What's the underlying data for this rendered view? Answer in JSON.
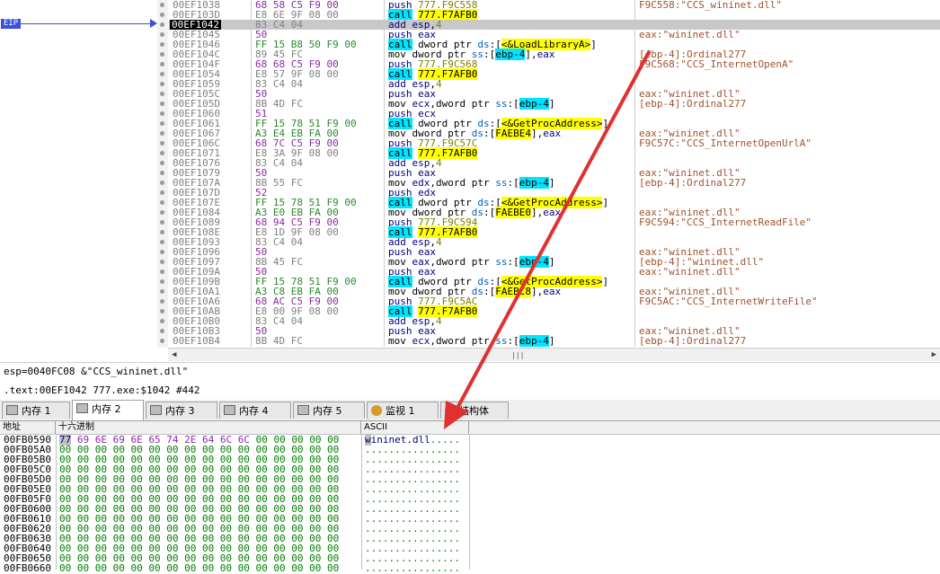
{
  "eip_label": "EIP",
  "disasm": {
    "rows": [
      {
        "addr": "00EF1038",
        "bytes": "68 58 C5 F9 00",
        "bclass": "p",
        "ins": [
          [
            "push ",
            "k-push"
          ],
          [
            "777.F9C558",
            "k-num"
          ]
        ],
        "cmt": "F9C558:\"CCS_wininet.dll\"",
        "cur": false
      },
      {
        "addr": "00EF103D",
        "bytes": "E8 6E 9F 08 00",
        "bclass": "",
        "ins": [
          [
            "call",
            "k-call"
          ],
          [
            " ",
            ""
          ],
          [
            "777.F7AFB0",
            "hlY"
          ]
        ],
        "cmt": "",
        "cur": false
      },
      {
        "addr": "00EF1042",
        "bytes": "83 C4 04",
        "bclass": "",
        "ins": [
          [
            "add ",
            "k-push"
          ],
          [
            "esp",
            "k-reg"
          ],
          [
            ",",
            ""
          ],
          [
            "4",
            "k-num"
          ]
        ],
        "cmt": "",
        "cur": true
      },
      {
        "addr": "00EF1045",
        "bytes": "50",
        "bclass": "p",
        "ins": [
          [
            "push ",
            "k-push"
          ],
          [
            "eax",
            "k-reg"
          ]
        ],
        "cmt": "eax:\"wininet.dll\"",
        "cur": false
      },
      {
        "addr": "00EF1046",
        "bytes": "FF 15 B8 50 F9 00",
        "bclass": "g",
        "ins": [
          [
            "call",
            "k-call"
          ],
          [
            " dword ptr ",
            ""
          ],
          [
            "ds",
            "k-seg"
          ],
          [
            ":[",
            ""
          ],
          [
            "<&LoadLibraryA>",
            "hlY"
          ],
          [
            "]",
            ""
          ]
        ],
        "cmt": "",
        "cur": false
      },
      {
        "addr": "00EF104C",
        "bytes": "89 45 FC",
        "bclass": "",
        "ins": [
          [
            "mov ",
            ""
          ],
          [
            "dword ptr ",
            ""
          ],
          [
            "ss",
            "k-seg"
          ],
          [
            ":[",
            ""
          ],
          [
            "ebp-4",
            "k-br"
          ],
          [
            "],",
            ""
          ],
          [
            "eax",
            "k-reg"
          ]
        ],
        "cmt": "[ebp-4]:Ordinal277",
        "cur": false
      },
      {
        "addr": "00EF104F",
        "bytes": "68 68 C5 F9 00",
        "bclass": "p",
        "ins": [
          [
            "push ",
            "k-push"
          ],
          [
            "777.F9C568",
            "k-num"
          ]
        ],
        "cmt": "F9C568:\"CCS_InternetOpenA\"",
        "cur": false
      },
      {
        "addr": "00EF1054",
        "bytes": "E8 57 9F 08 00",
        "bclass": "",
        "ins": [
          [
            "call",
            "k-call"
          ],
          [
            " ",
            ""
          ],
          [
            "777.F7AFB0",
            "hlY"
          ]
        ],
        "cmt": "",
        "cur": false
      },
      {
        "addr": "00EF1059",
        "bytes": "83 C4 04",
        "bclass": "",
        "ins": [
          [
            "add ",
            "k-push"
          ],
          [
            "esp",
            "k-reg"
          ],
          [
            ",",
            ""
          ],
          [
            "4",
            "k-num"
          ]
        ],
        "cmt": "",
        "cur": false
      },
      {
        "addr": "00EF105C",
        "bytes": "50",
        "bclass": "p",
        "ins": [
          [
            "push ",
            "k-push"
          ],
          [
            "eax",
            "k-reg"
          ]
        ],
        "cmt": "eax:\"wininet.dll\"",
        "cur": false
      },
      {
        "addr": "00EF105D",
        "bytes": "8B 4D FC",
        "bclass": "",
        "ins": [
          [
            "mov ",
            ""
          ],
          [
            "ecx",
            "k-reg"
          ],
          [
            ",dword ptr ",
            ""
          ],
          [
            "ss",
            "k-seg"
          ],
          [
            ":[",
            ""
          ],
          [
            "ebp-4",
            "k-br"
          ],
          [
            "]",
            ""
          ]
        ],
        "cmt": "[ebp-4]:Ordinal277",
        "cur": false
      },
      {
        "addr": "00EF1060",
        "bytes": "51",
        "bclass": "p",
        "ins": [
          [
            "push ",
            "k-push"
          ],
          [
            "ecx",
            "k-reg"
          ]
        ],
        "cmt": "",
        "cur": false
      },
      {
        "addr": "00EF1061",
        "bytes": "FF 15 78 51 F9 00",
        "bclass": "g",
        "ins": [
          [
            "call",
            "k-call"
          ],
          [
            " dword ptr ",
            ""
          ],
          [
            "ds",
            "k-seg"
          ],
          [
            ":[",
            ""
          ],
          [
            "<&GetProcAddress>",
            "hlY"
          ],
          [
            "]",
            ""
          ]
        ],
        "cmt": "",
        "cur": false
      },
      {
        "addr": "00EF1067",
        "bytes": "A3 E4 EB FA 00",
        "bclass": "g",
        "ins": [
          [
            "mov ",
            ""
          ],
          [
            "dword ptr ",
            ""
          ],
          [
            "ds",
            "k-seg"
          ],
          [
            ":[",
            ""
          ],
          [
            "FAEBE4",
            "hlY"
          ],
          [
            "],",
            ""
          ],
          [
            "eax",
            "k-reg"
          ]
        ],
        "cmt": "eax:\"wininet.dll\"",
        "cur": false
      },
      {
        "addr": "00EF106C",
        "bytes": "68 7C C5 F9 00",
        "bclass": "p",
        "ins": [
          [
            "push ",
            "k-push"
          ],
          [
            "777.F9C57C",
            "k-num"
          ]
        ],
        "cmt": "F9C57C:\"CCS_InternetOpenUrlA\"",
        "cur": false
      },
      {
        "addr": "00EF1071",
        "bytes": "E8 3A 9F 08 00",
        "bclass": "",
        "ins": [
          [
            "call",
            "k-call"
          ],
          [
            " ",
            ""
          ],
          [
            "777.F7AFB0",
            "hlY"
          ]
        ],
        "cmt": "",
        "cur": false
      },
      {
        "addr": "00EF1076",
        "bytes": "83 C4 04",
        "bclass": "",
        "ins": [
          [
            "add ",
            "k-push"
          ],
          [
            "esp",
            "k-reg"
          ],
          [
            ",",
            ""
          ],
          [
            "4",
            "k-num"
          ]
        ],
        "cmt": "",
        "cur": false
      },
      {
        "addr": "00EF1079",
        "bytes": "50",
        "bclass": "p",
        "ins": [
          [
            "push ",
            "k-push"
          ],
          [
            "eax",
            "k-reg"
          ]
        ],
        "cmt": "eax:\"wininet.dll\"",
        "cur": false
      },
      {
        "addr": "00EF107A",
        "bytes": "8B 55 FC",
        "bclass": "",
        "ins": [
          [
            "mov ",
            ""
          ],
          [
            "edx",
            "k-reg"
          ],
          [
            ",dword ptr ",
            ""
          ],
          [
            "ss",
            "k-seg"
          ],
          [
            ":[",
            ""
          ],
          [
            "ebp-4",
            "k-br"
          ],
          [
            "]",
            ""
          ]
        ],
        "cmt": "[ebp-4]:Ordinal277",
        "cur": false
      },
      {
        "addr": "00EF107D",
        "bytes": "52",
        "bclass": "p",
        "ins": [
          [
            "push ",
            "k-push"
          ],
          [
            "edx",
            "k-reg"
          ]
        ],
        "cmt": "",
        "cur": false
      },
      {
        "addr": "00EF107E",
        "bytes": "FF 15 78 51 F9 00",
        "bclass": "g",
        "ins": [
          [
            "call",
            "k-call"
          ],
          [
            " dword ptr ",
            ""
          ],
          [
            "ds",
            "k-seg"
          ],
          [
            ":[",
            ""
          ],
          [
            "<&GetProcAddress>",
            "hlY"
          ],
          [
            "]",
            ""
          ]
        ],
        "cmt": "",
        "cur": false
      },
      {
        "addr": "00EF1084",
        "bytes": "A3 E0 EB FA 00",
        "bclass": "g",
        "ins": [
          [
            "mov ",
            ""
          ],
          [
            "dword ptr ",
            ""
          ],
          [
            "ds",
            "k-seg"
          ],
          [
            ":[",
            ""
          ],
          [
            "FAEBE0",
            "hlY"
          ],
          [
            "],",
            ""
          ],
          [
            "eax",
            "k-reg"
          ]
        ],
        "cmt": "eax:\"wininet.dll\"",
        "cur": false
      },
      {
        "addr": "00EF1089",
        "bytes": "68 94 C5 F9 00",
        "bclass": "p",
        "ins": [
          [
            "push ",
            "k-push"
          ],
          [
            "777.F9C594",
            "k-num"
          ]
        ],
        "cmt": "F9C594:\"CCS_InternetReadFile\"",
        "cur": false
      },
      {
        "addr": "00EF108E",
        "bytes": "E8 1D 9F 08 00",
        "bclass": "",
        "ins": [
          [
            "call",
            "k-call"
          ],
          [
            " ",
            ""
          ],
          [
            "777.F7AFB0",
            "hlY"
          ]
        ],
        "cmt": "",
        "cur": false
      },
      {
        "addr": "00EF1093",
        "bytes": "83 C4 04",
        "bclass": "",
        "ins": [
          [
            "add ",
            "k-push"
          ],
          [
            "esp",
            "k-reg"
          ],
          [
            ",",
            ""
          ],
          [
            "4",
            "k-num"
          ]
        ],
        "cmt": "",
        "cur": false
      },
      {
        "addr": "00EF1096",
        "bytes": "50",
        "bclass": "p",
        "ins": [
          [
            "push ",
            "k-push"
          ],
          [
            "eax",
            "k-reg"
          ]
        ],
        "cmt": "eax:\"wininet.dll\"",
        "cur": false
      },
      {
        "addr": "00EF1097",
        "bytes": "8B 45 FC",
        "bclass": "",
        "ins": [
          [
            "mov ",
            ""
          ],
          [
            "eax",
            "k-reg"
          ],
          [
            ",dword ptr ",
            ""
          ],
          [
            "ss",
            "k-seg"
          ],
          [
            ":[",
            ""
          ],
          [
            "ebp-4",
            "k-br"
          ],
          [
            "]",
            ""
          ]
        ],
        "cmt": "[ebp-4]:\"wininet.dll\"",
        "cur": false
      },
      {
        "addr": "00EF109A",
        "bytes": "50",
        "bclass": "p",
        "ins": [
          [
            "push ",
            "k-push"
          ],
          [
            "eax",
            "k-reg"
          ]
        ],
        "cmt": "eax:\"wininet.dll\"",
        "cur": false
      },
      {
        "addr": "00EF109B",
        "bytes": "FF 15 78 51 F9 00",
        "bclass": "g",
        "ins": [
          [
            "call",
            "k-call"
          ],
          [
            " dword ptr ",
            ""
          ],
          [
            "ds",
            "k-seg"
          ],
          [
            ":[",
            ""
          ],
          [
            "<&GetProcAddress>",
            "hlY"
          ],
          [
            "]",
            ""
          ]
        ],
        "cmt": "",
        "cur": false
      },
      {
        "addr": "00EF10A1",
        "bytes": "A3 C8 EB FA 00",
        "bclass": "g",
        "ins": [
          [
            "mov ",
            ""
          ],
          [
            "dword ptr ",
            ""
          ],
          [
            "ds",
            "k-seg"
          ],
          [
            ":[",
            ""
          ],
          [
            "FAEBC8",
            "hlY"
          ],
          [
            "],",
            ""
          ],
          [
            "eax",
            "k-reg"
          ]
        ],
        "cmt": "eax:\"wininet.dll\"",
        "cur": false
      },
      {
        "addr": "00EF10A6",
        "bytes": "68 AC C5 F9 00",
        "bclass": "p",
        "ins": [
          [
            "push ",
            "k-push"
          ],
          [
            "777.F9C5AC",
            "k-num"
          ]
        ],
        "cmt": "F9C5AC:\"CCS_InternetWriteFile\"",
        "cur": false
      },
      {
        "addr": "00EF10AB",
        "bytes": "E8 00 9F 08 00",
        "bclass": "",
        "ins": [
          [
            "call",
            "k-call"
          ],
          [
            " ",
            ""
          ],
          [
            "777.F7AFB0",
            "hlY"
          ]
        ],
        "cmt": "",
        "cur": false
      },
      {
        "addr": "00EF10B0",
        "bytes": "83 C4 04",
        "bclass": "",
        "ins": [
          [
            "add ",
            "k-push"
          ],
          [
            "esp",
            "k-reg"
          ],
          [
            ",",
            ""
          ],
          [
            "4",
            "k-num"
          ]
        ],
        "cmt": "",
        "cur": false
      },
      {
        "addr": "00EF10B3",
        "bytes": "50",
        "bclass": "p",
        "ins": [
          [
            "push ",
            "k-push"
          ],
          [
            "eax",
            "k-reg"
          ]
        ],
        "cmt": "eax:\"wininet.dll\"",
        "cur": false
      },
      {
        "addr": "00EF10B4",
        "bytes": "8B 4D FC",
        "bclass": "",
        "ins": [
          [
            "mov ",
            ""
          ],
          [
            "ecx",
            "k-reg"
          ],
          [
            ",dword ptr ",
            ""
          ],
          [
            "ss",
            "k-seg"
          ],
          [
            ":[",
            ""
          ],
          [
            "ebp-4",
            "k-br"
          ],
          [
            "]",
            ""
          ]
        ],
        "cmt": "[ebp-4]:Ordinal277",
        "cur": false
      }
    ]
  },
  "info": {
    "line1": "esp=0040FC08 &\"CCS_wininet.dll\"",
    "line2": ".text:00EF1042 777.exe:$1042 #442"
  },
  "tabs": [
    {
      "label": "内存 1",
      "icon": "memory-icon",
      "active": false
    },
    {
      "label": "内存 2",
      "icon": "memory-icon",
      "active": true
    },
    {
      "label": "内存 3",
      "icon": "memory-icon",
      "active": false
    },
    {
      "label": "内存 4",
      "icon": "memory-icon",
      "active": false
    },
    {
      "label": "内存 5",
      "icon": "memory-icon",
      "active": false
    },
    {
      "label": "监视 1",
      "icon": "watch-icon",
      "active": false
    },
    {
      "label": "结构体",
      "icon": "struct-icon",
      "active": false
    }
  ],
  "dump": {
    "headers": {
      "addr": "地址",
      "hex": "十六进制",
      "ascii": "ASCII"
    },
    "rows": [
      {
        "addr": "00FB0590",
        "hex": "77 69 6E 69 6E 65 74 2E 64 6C 6C 00 00 00 00 00",
        "ascii": "wininet.dll....."
      },
      {
        "addr": "00FB05A0",
        "hex": "00 00 00 00 00 00 00 00 00 00 00 00 00 00 00 00",
        "ascii": "................"
      },
      {
        "addr": "00FB05B0",
        "hex": "00 00 00 00 00 00 00 00 00 00 00 00 00 00 00 00",
        "ascii": "................"
      },
      {
        "addr": "00FB05C0",
        "hex": "00 00 00 00 00 00 00 00 00 00 00 00 00 00 00 00",
        "ascii": "................"
      },
      {
        "addr": "00FB05D0",
        "hex": "00 00 00 00 00 00 00 00 00 00 00 00 00 00 00 00",
        "ascii": "................"
      },
      {
        "addr": "00FB05E0",
        "hex": "00 00 00 00 00 00 00 00 00 00 00 00 00 00 00 00",
        "ascii": "................"
      },
      {
        "addr": "00FB05F0",
        "hex": "00 00 00 00 00 00 00 00 00 00 00 00 00 00 00 00",
        "ascii": "................"
      },
      {
        "addr": "00FB0600",
        "hex": "00 00 00 00 00 00 00 00 00 00 00 00 00 00 00 00",
        "ascii": "................"
      },
      {
        "addr": "00FB0610",
        "hex": "00 00 00 00 00 00 00 00 00 00 00 00 00 00 00 00",
        "ascii": "................"
      },
      {
        "addr": "00FB0620",
        "hex": "00 00 00 00 00 00 00 00 00 00 00 00 00 00 00 00",
        "ascii": "................"
      },
      {
        "addr": "00FB0630",
        "hex": "00 00 00 00 00 00 00 00 00 00 00 00 00 00 00 00",
        "ascii": "................"
      },
      {
        "addr": "00FB0640",
        "hex": "00 00 00 00 00 00 00 00 00 00 00 00 00 00 00 00",
        "ascii": "................"
      },
      {
        "addr": "00FB0650",
        "hex": "00 00 00 00 00 00 00 00 00 00 00 00 00 00 00 00",
        "ascii": "................"
      },
      {
        "addr": "00FB0660",
        "hex": "00 00 00 00 00 00 00 00 00 00 00 00 00 00 00 00",
        "ascii": "................"
      }
    ]
  },
  "colors": {
    "eip": "#3c4fd6",
    "call_bg": "#00e5ff",
    "highlight": "#ffff00",
    "annotation": "#e03030"
  }
}
